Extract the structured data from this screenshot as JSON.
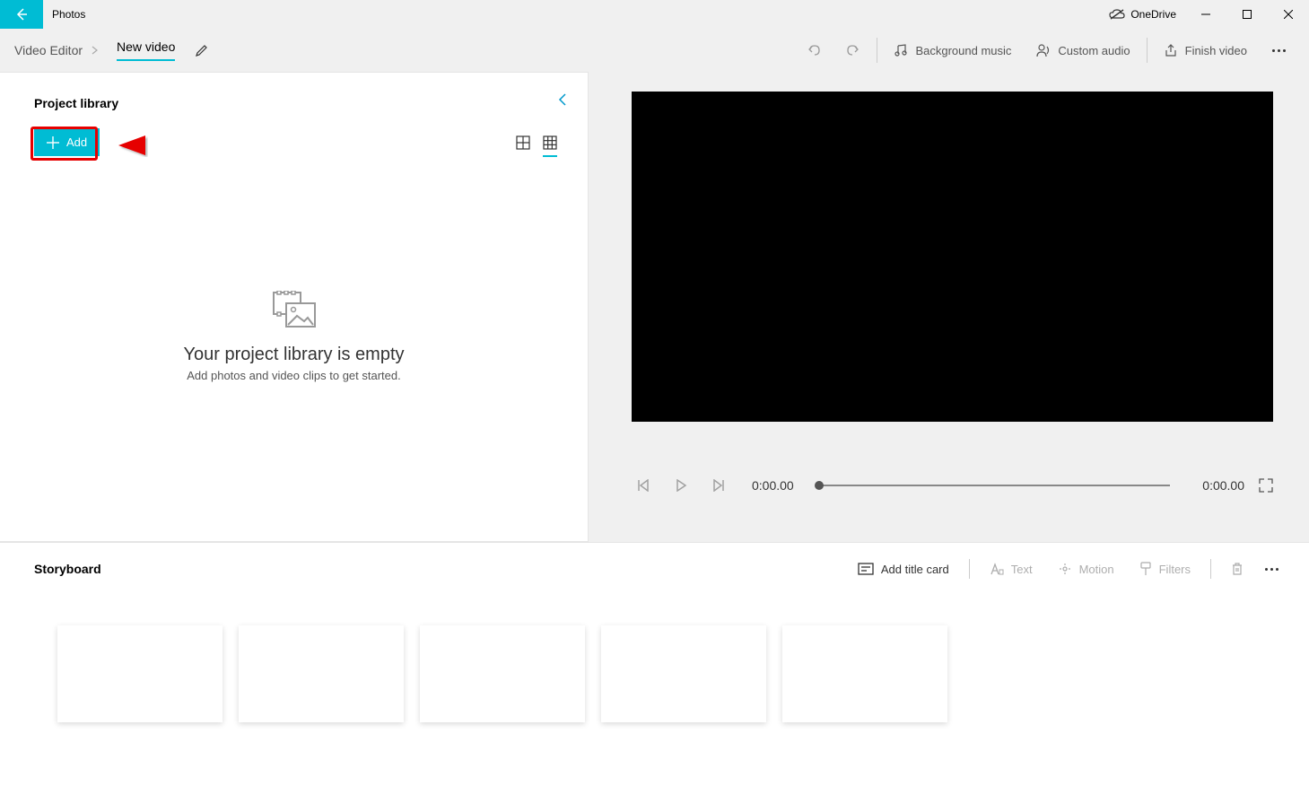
{
  "app": {
    "title": "Photos"
  },
  "titlebar": {
    "onedrive": "OneDrive"
  },
  "breadcrumb": {
    "root": "Video Editor",
    "current": "New video"
  },
  "toolbar": {
    "bg_music": "Background music",
    "custom_audio": "Custom audio",
    "finish": "Finish video"
  },
  "library": {
    "title": "Project library",
    "add_label": "Add",
    "empty_title": "Your project library is empty",
    "empty_sub": "Add photos and video clips to get started."
  },
  "player": {
    "time_current": "0:00.00",
    "time_total": "0:00.00"
  },
  "storyboard": {
    "title": "Storyboard",
    "add_title_card": "Add title card",
    "text": "Text",
    "motion": "Motion",
    "filters": "Filters"
  }
}
